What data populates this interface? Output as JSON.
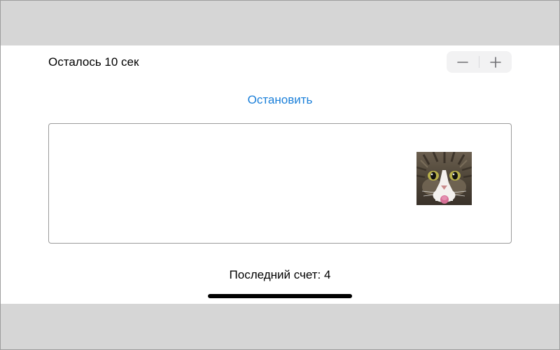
{
  "header": {
    "timer_text": "Осталось 10 сек"
  },
  "stepper": {
    "decrement_icon": "minus-icon",
    "increment_icon": "plus-icon"
  },
  "controls": {
    "stop_label": "Остановить"
  },
  "game_field": {
    "target_image": "cat-face"
  },
  "footer": {
    "score_text": "Последний счет: 4"
  },
  "colors": {
    "accent": "#1a7fd9",
    "stepper_bg": "#f2f2f3",
    "field_border": "#9b9b9b",
    "outer_bg": "#d6d6d6"
  }
}
